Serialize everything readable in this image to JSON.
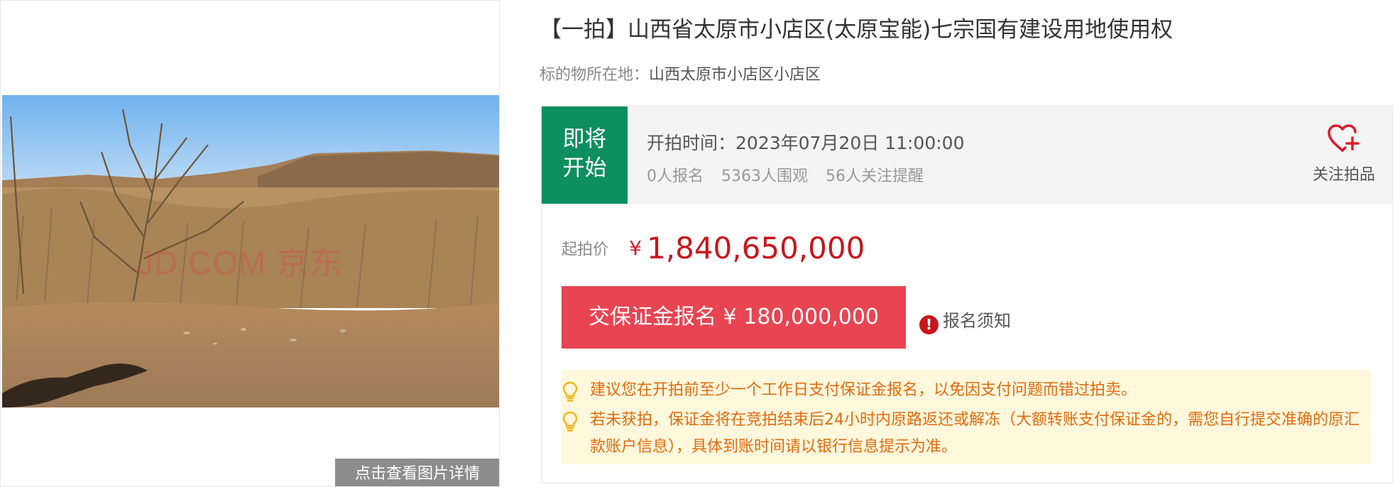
{
  "gallery": {
    "watermark": "JD.COM 京东",
    "detail_button": "点击查看图片详情"
  },
  "listing": {
    "title": "【一拍】山西省太原市小店区(太原宝能)七宗国有建设用地使用权",
    "location_label": "标的物所在地：",
    "location_value": "山西太原市小店区小店区"
  },
  "status": {
    "badge_line1": "即将",
    "badge_line2": "开始",
    "start_time": "开拍时间：2023年07月20日 11:00:00",
    "signups": "0人报名",
    "views": "5363人围观",
    "reminders": "56人关注提醒",
    "follow_label": "关注拍品"
  },
  "price": {
    "label": "起拍价",
    "currency": "¥",
    "value": "1,840,650,000"
  },
  "actions": {
    "deposit_button": "交保证金报名 ¥ 180,000,000",
    "notice_link": "报名须知",
    "notice_icon": "!"
  },
  "tips": [
    "建议您在开拍前至少一个工作日支付保证金报名，以免因支付问题而错过拍卖。",
    "若未获拍，保证金将在竞拍结束后24小时内原路返还或解冻（大额转账支付保证金的，需您自行提交准确的原汇款账户信息），具体到账时间请以银行信息提示为准。"
  ],
  "colors": {
    "status_green": "#0e8f5f",
    "price_red": "#c8161d",
    "deposit_button": "#e84452",
    "tip_orange": "#e06b10",
    "tip_background": "#fff8dc"
  },
  "icons": {
    "follow": "heart-plus-icon",
    "tip": "lightbulb-icon",
    "notice": "exclamation-circle-icon"
  }
}
